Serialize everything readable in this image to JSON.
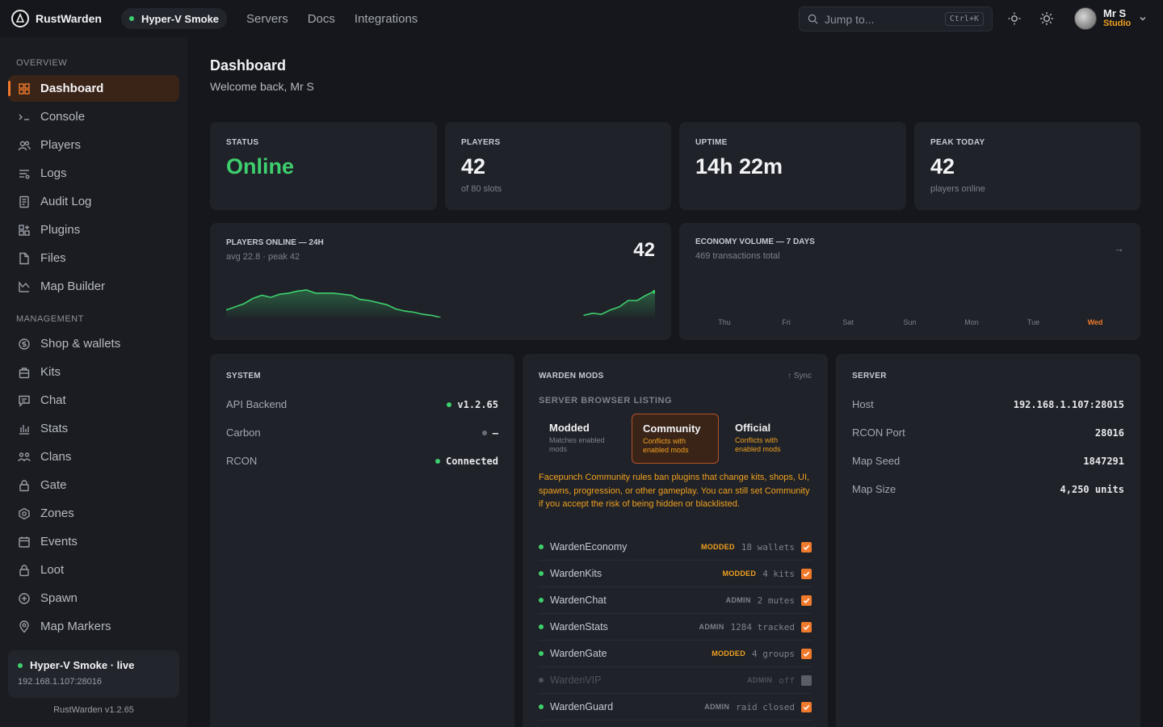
{
  "app": {
    "name": "RustWarden"
  },
  "server_pill": {
    "label": "Hyper-V Smoke"
  },
  "topnav": [
    "Servers",
    "Docs",
    "Integrations"
  ],
  "search": {
    "placeholder": "Jump to...",
    "shortcut": "Ctrl+K"
  },
  "user": {
    "name": "Mr S",
    "org": "Studio"
  },
  "sidebar": {
    "overview_title": "OVERVIEW",
    "management_title": "MANAGEMENT",
    "overview": [
      {
        "label": "Dashboard",
        "icon": "grid-icon",
        "active": true
      },
      {
        "label": "Console",
        "icon": "terminal-icon"
      },
      {
        "label": "Players",
        "icon": "users-icon"
      },
      {
        "label": "Logs",
        "icon": "list-icon"
      },
      {
        "label": "Audit Log",
        "icon": "document-icon"
      },
      {
        "label": "Plugins",
        "icon": "puzzle-icon"
      },
      {
        "label": "Files",
        "icon": "file-icon"
      },
      {
        "label": "Map Builder",
        "icon": "map-icon"
      }
    ],
    "management": [
      {
        "label": "Shop & wallets",
        "icon": "coin-icon"
      },
      {
        "label": "Kits",
        "icon": "bag-icon"
      },
      {
        "label": "Chat",
        "icon": "chat-icon"
      },
      {
        "label": "Stats",
        "icon": "bar-chart-icon"
      },
      {
        "label": "Clans",
        "icon": "group-icon"
      },
      {
        "label": "Gate",
        "icon": "lock-icon"
      },
      {
        "label": "Zones",
        "icon": "zone-icon"
      },
      {
        "label": "Events",
        "icon": "calendar-icon"
      },
      {
        "label": "Loot",
        "icon": "lock-icon"
      },
      {
        "label": "Spawn",
        "icon": "plus-circle-icon"
      },
      {
        "label": "Map Markers",
        "icon": "pin-icon"
      }
    ],
    "live": {
      "name": "Hyper-V Smoke · live",
      "address": "192.168.1.107:28016"
    },
    "version": "RustWarden v1.2.65"
  },
  "page": {
    "title": "Dashboard",
    "subtitle": "Welcome back, Mr S"
  },
  "stats": [
    {
      "label": "STATUS",
      "value": "Online",
      "sub": ""
    },
    {
      "label": "PLAYERS",
      "value": "42",
      "sub": "of 80 slots"
    },
    {
      "label": "UPTIME",
      "value": "14h 22m",
      "sub": ""
    },
    {
      "label": "PEAK TODAY",
      "value": "42",
      "sub": "players online"
    }
  ],
  "players_chart": {
    "title": "PLAYERS ONLINE — 24H",
    "subtitle": "avg 22.8 · peak 42",
    "current": "42"
  },
  "economy_chart": {
    "title": "ECONOMY VOLUME — 7 DAYS",
    "subtitle": "469 transactions total",
    "days": [
      "Thu",
      "Fri",
      "Sat",
      "Sun",
      "Mon",
      "Tue",
      "Wed"
    ],
    "today": "Wed"
  },
  "chart_data": {
    "type": "area",
    "title": "PLAYERS ONLINE — 24H",
    "x": [
      0,
      1,
      2,
      3,
      4,
      5,
      6,
      7,
      8,
      9,
      10,
      11,
      12,
      13,
      14,
      15,
      16,
      17,
      18,
      19,
      20,
      21,
      22,
      23,
      24,
      25,
      26,
      27,
      28,
      29,
      30,
      31,
      32,
      33,
      34,
      35,
      36,
      37,
      38,
      39,
      40,
      41,
      42,
      43,
      44,
      45,
      46,
      47,
      48
    ],
    "series": [
      {
        "values": [
          7,
          10,
          13,
          18,
          21,
          19,
          22,
          23,
          25,
          26,
          23,
          23,
          23,
          22,
          21,
          17,
          16,
          14,
          12,
          8,
          6,
          5,
          3,
          2,
          0,
          null,
          null,
          null,
          null,
          null,
          null,
          null,
          null,
          null,
          null,
          null,
          null,
          null,
          null,
          null,
          2,
          4,
          3,
          7,
          10,
          16,
          16,
          21,
          25
        ]
      }
    ],
    "ylim": [
      0,
      42
    ]
  },
  "system": {
    "title": "SYSTEM",
    "rows": [
      {
        "key": "API Backend",
        "value": "v1.2.65",
        "status": "ok"
      },
      {
        "key": "Carbon",
        "value": "—",
        "status": "off"
      },
      {
        "key": "RCON",
        "value": "Connected",
        "status": "ok"
      }
    ]
  },
  "mods": {
    "title": "WARDEN MODS",
    "sync": "↑ Sync",
    "listing_title": "SERVER BROWSER LISTING",
    "options": [
      {
        "title": "Modded",
        "desc": "Matches enabled mods",
        "selected": false,
        "warn": false
      },
      {
        "title": "Community",
        "desc": "Conflicts with enabled mods",
        "selected": true,
        "warn": true
      },
      {
        "title": "Official",
        "desc": "Conflicts with enabled mods",
        "selected": false,
        "warn": true
      }
    ],
    "warning": "Facepunch Community rules ban plugins that change kits, shops, UI, spawns, progression, or other gameplay. You can still set Community if you accept the risk of being hidden or blacklisted.",
    "list": [
      {
        "name": "WardenEconomy",
        "tag": "MODDED",
        "info": "18 wallets",
        "enabled": true
      },
      {
        "name": "WardenKits",
        "tag": "MODDED",
        "info": "4 kits",
        "enabled": true
      },
      {
        "name": "WardenChat",
        "tag": "ADMIN",
        "info": "2 mutes",
        "enabled": true
      },
      {
        "name": "WardenStats",
        "tag": "ADMIN",
        "info": "1284 tracked",
        "enabled": true
      },
      {
        "name": "WardenGate",
        "tag": "MODDED",
        "info": "4 groups",
        "enabled": true
      },
      {
        "name": "WardenVIP",
        "tag": "ADMIN",
        "info": "off",
        "enabled": false
      },
      {
        "name": "WardenGuard",
        "tag": "ADMIN",
        "info": "raid closed",
        "enabled": true
      }
    ]
  },
  "server": {
    "title": "SERVER",
    "rows": [
      {
        "key": "Host",
        "value": "192.168.1.107:28015"
      },
      {
        "key": "RCON Port",
        "value": "28016"
      },
      {
        "key": "Map Seed",
        "value": "1847291"
      },
      {
        "key": "Map Size",
        "value": "4,250 units"
      }
    ]
  },
  "colors": {
    "accent": "#f07a2c",
    "online": "#3ecf6e",
    "warning": "#f0a020"
  }
}
